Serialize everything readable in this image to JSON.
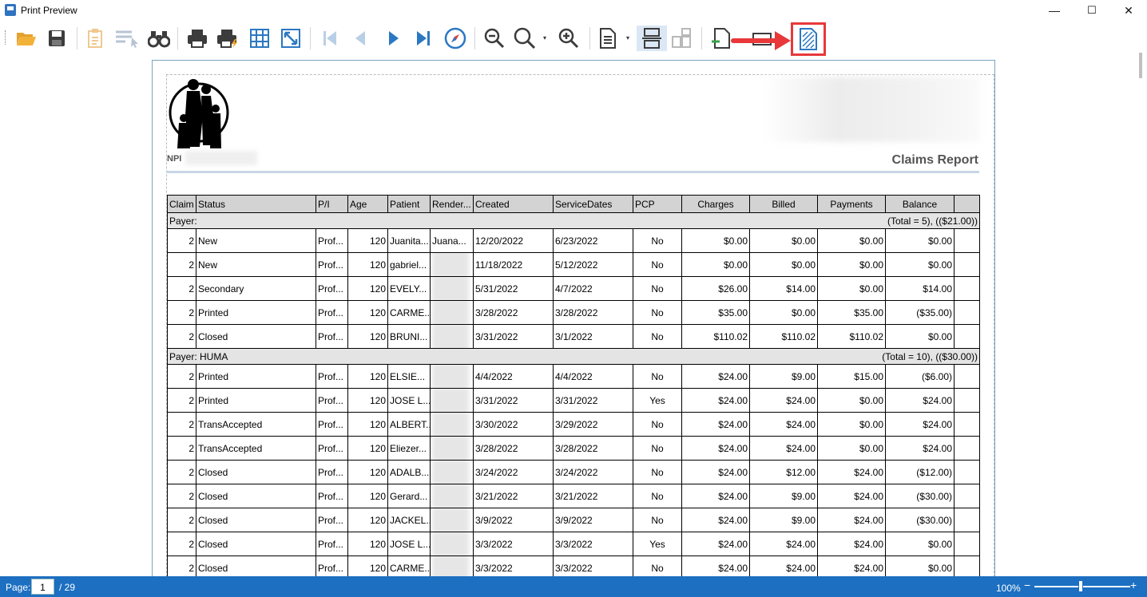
{
  "window": {
    "title": "Print Preview",
    "minimize": "—",
    "maximize": "☐",
    "close": "✕"
  },
  "toolbar": {
    "icons": [
      "open-icon",
      "save-icon",
      "parameters-icon",
      "editing-fields-icon",
      "find-icon",
      "print-icon",
      "quick-print-icon",
      "page-setup-icon",
      "scale-icon",
      "first-page-icon",
      "previous-page-icon",
      "next-page-icon",
      "last-page-icon",
      "navigation-icon",
      "zoom-out-icon",
      "zoom-icon",
      "zoom-in-icon",
      "view-icon",
      "page-layout-icon",
      "continuous-icon",
      "export-icon",
      "send-icon",
      "watermark-icon"
    ],
    "dropdown_glyph": "▾"
  },
  "report": {
    "npi_label": "NPI",
    "title": "Claims Report",
    "columns": [
      "Claim",
      "Status",
      "P/I",
      "Age",
      "Patient",
      "Render...",
      "Created",
      "ServiceDates",
      "PCP",
      "Charges",
      "Billed",
      "Payments",
      "Balance",
      ""
    ],
    "groups": [
      {
        "label": "Payer:",
        "total": "(Total = 5), (($21.00))",
        "rows": [
          {
            "claim": "2",
            "status": "New",
            "pi": "Prof...",
            "age": "120",
            "patient": "Juanita...",
            "render": "Juana...",
            "created": "12/20/2022",
            "service": "6/23/2022",
            "pcp": "No",
            "charges": "$0.00",
            "billed": "$0.00",
            "payments": "$0.00",
            "balance": "$0.00"
          },
          {
            "claim": "2",
            "status": "New",
            "pi": "Prof...",
            "age": "120",
            "patient": "gabriel...",
            "render": "",
            "created": "11/18/2022",
            "service": "5/12/2022",
            "pcp": "No",
            "charges": "$0.00",
            "billed": "$0.00",
            "payments": "$0.00",
            "balance": "$0.00"
          },
          {
            "claim": "2",
            "status": "Secondary",
            "pi": "Prof...",
            "age": "120",
            "patient": "EVELY...",
            "render": "",
            "created": "5/31/2022",
            "service": "4/7/2022",
            "pcp": "No",
            "charges": "$26.00",
            "billed": "$14.00",
            "payments": "$0.00",
            "balance": "$14.00"
          },
          {
            "claim": "2",
            "status": "Printed",
            "pi": "Prof...",
            "age": "120",
            "patient": "CARME...",
            "render": "",
            "created": "3/28/2022",
            "service": "3/28/2022",
            "pcp": "No",
            "charges": "$35.00",
            "billed": "$0.00",
            "payments": "$35.00",
            "balance": "($35.00)"
          },
          {
            "claim": "2",
            "status": "Closed",
            "pi": "Prof...",
            "age": "120",
            "patient": "BRUNI...",
            "render": "",
            "created": "3/31/2022",
            "service": "3/1/2022",
            "pcp": "No",
            "charges": "$110.02",
            "billed": "$110.02",
            "payments": "$110.02",
            "balance": "$0.00"
          }
        ]
      },
      {
        "label": "Payer: HUMA",
        "total": "(Total = 10), (($30.00))",
        "rows": [
          {
            "claim": "2",
            "status": "Printed",
            "pi": "Prof...",
            "age": "120",
            "patient": "ELSIE...",
            "render": "",
            "created": "4/4/2022",
            "service": "4/4/2022",
            "pcp": "No",
            "charges": "$24.00",
            "billed": "$9.00",
            "payments": "$15.00",
            "balance": "($6.00)"
          },
          {
            "claim": "2",
            "status": "Printed",
            "pi": "Prof...",
            "age": "120",
            "patient": "JOSE L...",
            "render": "",
            "created": "3/31/2022",
            "service": "3/31/2022",
            "pcp": "Yes",
            "charges": "$24.00",
            "billed": "$24.00",
            "payments": "$0.00",
            "balance": "$24.00"
          },
          {
            "claim": "2",
            "status": "TransAccepted",
            "pi": "Prof...",
            "age": "120",
            "patient": "ALBERT...",
            "render": "",
            "created": "3/30/2022",
            "service": "3/29/2022",
            "pcp": "No",
            "charges": "$24.00",
            "billed": "$24.00",
            "payments": "$0.00",
            "balance": "$24.00"
          },
          {
            "claim": "2",
            "status": "TransAccepted",
            "pi": "Prof...",
            "age": "120",
            "patient": "Eliezer...",
            "render": "",
            "created": "3/28/2022",
            "service": "3/28/2022",
            "pcp": "No",
            "charges": "$24.00",
            "billed": "$24.00",
            "payments": "$0.00",
            "balance": "$24.00"
          },
          {
            "claim": "2",
            "status": "Closed",
            "pi": "Prof...",
            "age": "120",
            "patient": "ADALB...",
            "render": "",
            "created": "3/24/2022",
            "service": "3/24/2022",
            "pcp": "No",
            "charges": "$24.00",
            "billed": "$12.00",
            "payments": "$24.00",
            "balance": "($12.00)"
          },
          {
            "claim": "2",
            "status": "Closed",
            "pi": "Prof...",
            "age": "120",
            "patient": "Gerard...",
            "render": "",
            "created": "3/21/2022",
            "service": "3/21/2022",
            "pcp": "No",
            "charges": "$24.00",
            "billed": "$9.00",
            "payments": "$24.00",
            "balance": "($30.00)"
          },
          {
            "claim": "2",
            "status": "Closed",
            "pi": "Prof...",
            "age": "120",
            "patient": "JACKEL...",
            "render": "",
            "created": "3/9/2022",
            "service": "3/9/2022",
            "pcp": "No",
            "charges": "$24.00",
            "billed": "$9.00",
            "payments": "$24.00",
            "balance": "($30.00)"
          },
          {
            "claim": "2",
            "status": "Closed",
            "pi": "Prof...",
            "age": "120",
            "patient": "JOSE L...",
            "render": "",
            "created": "3/3/2022",
            "service": "3/3/2022",
            "pcp": "Yes",
            "charges": "$24.00",
            "billed": "$24.00",
            "payments": "$24.00",
            "balance": "$0.00"
          },
          {
            "claim": "2",
            "status": "Closed",
            "pi": "Prof...",
            "age": "120",
            "patient": "CARME...",
            "render": "",
            "created": "3/3/2022",
            "service": "3/3/2022",
            "pcp": "No",
            "charges": "$24.00",
            "billed": "$24.00",
            "payments": "$24.00",
            "balance": "$0.00"
          }
        ]
      }
    ]
  },
  "statusbar": {
    "page_label": "Page:",
    "page_value": "1",
    "page_total": "/ 29",
    "zoom": "100%",
    "zoom_minus": "−",
    "zoom_plus": "+",
    "zoom_level": 1.0
  },
  "colors": {
    "statusbar": "#1c6fc1",
    "annotation": "#e8383a",
    "icon_blue": "#2b78c2",
    "icon_gray": "#3c3c3c"
  }
}
